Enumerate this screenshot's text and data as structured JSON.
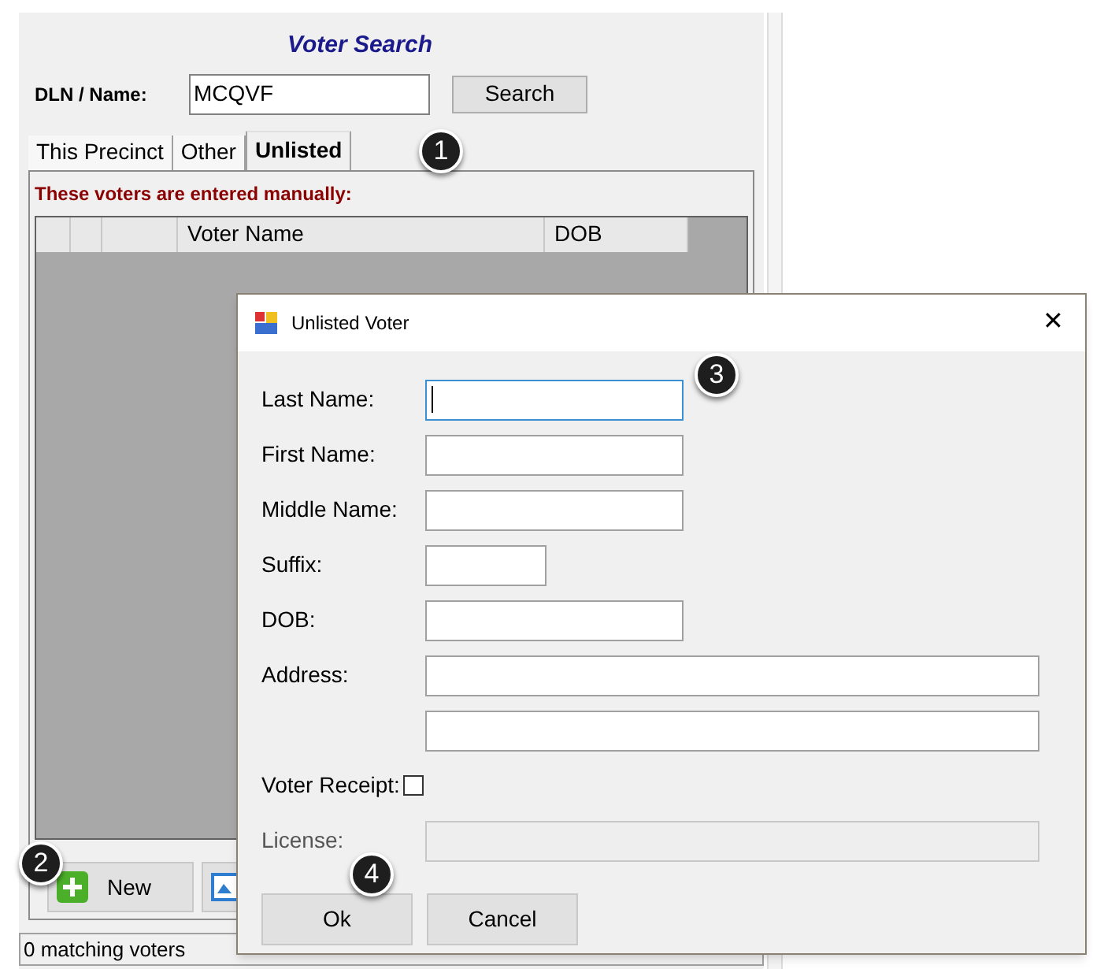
{
  "window": {
    "title": "Voter Search"
  },
  "search": {
    "label": "DLN / Name:",
    "value": "MCQVF",
    "button": "Search"
  },
  "tabs": [
    {
      "label": "This Precinct",
      "selected": false
    },
    {
      "label": "Other",
      "selected": false
    },
    {
      "label": "Unlisted",
      "selected": true
    }
  ],
  "notice": "These voters are entered manually:",
  "table": {
    "columns": [
      "",
      "",
      "",
      "Voter Name",
      "DOB"
    ]
  },
  "buttons": [
    {
      "label": "New",
      "kind": "add"
    },
    {
      "kind": "image"
    }
  ],
  "status_bar": "0 matching voters",
  "dialog": {
    "title": "Unlisted Voter",
    "close": "✕",
    "fields": [
      {
        "label": "Last Name:",
        "kind": "text",
        "focused": true
      },
      {
        "label": "First Name:",
        "kind": "text",
        "focused": false
      },
      {
        "label": "Middle Name:",
        "kind": "text",
        "focused": false
      },
      {
        "label": "Suffix:",
        "kind": "short",
        "focused": false
      },
      {
        "label": "DOB:",
        "kind": "text",
        "focused": false
      },
      {
        "label": "Address:",
        "kind": "wide",
        "focused": false
      },
      {
        "kind": "wide",
        "focused": false
      },
      {
        "label": "Voter Receipt:",
        "kind": "checkbox",
        "checked": false
      },
      {
        "label": "License:",
        "kind": "wide",
        "focused": false,
        "disabled": true
      }
    ],
    "buttons": [
      "Ok",
      "Cancel"
    ]
  },
  "callouts": [
    "1",
    "2",
    "3",
    "4"
  ]
}
